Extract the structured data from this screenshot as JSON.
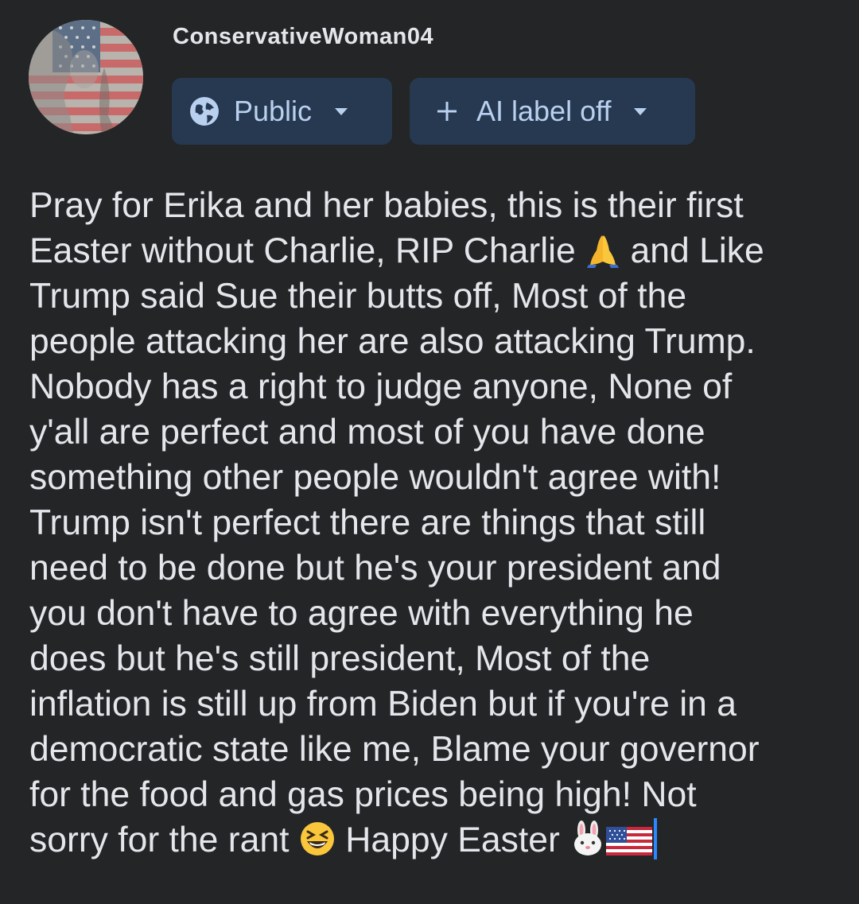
{
  "author": {
    "name": "ConservativeWoman04",
    "avatar_icon": "avatar-flag-portrait"
  },
  "privacy_chip": {
    "icon": "globe-icon",
    "label": "Public",
    "dropdown_icon": "caret-down-icon"
  },
  "ai_chip": {
    "icon": "plus-icon",
    "label": "AI label off",
    "dropdown_icon": "caret-down-icon"
  },
  "post": {
    "lines": [
      "Pray for Erika and her babies, this is their first",
      "Easter without Charlie, RIP Charlie",
      "and Like",
      "Trump said Sue their butts off, Most of the",
      "people attacking her are also attacking Trump.",
      "Nobody has a right to judge anyone, None of",
      "y'all are perfect and most of you have done",
      "something other people wouldn't agree with!",
      "Trump isn't perfect there are things that still",
      "need to be done but he's your president and",
      "you don't have to agree with everything he",
      "does but he's still president, Most of the",
      "inflation is still up from Biden but if you're in a",
      "democratic state like me, Blame your governor",
      "for the food and gas prices being high! Not",
      "sorry for the rant",
      "Happy Easter"
    ],
    "emojis": [
      "folded-hands-emoji",
      "grinning-squinting-face-emoji",
      "rabbit-face-emoji",
      "us-flag-emoji"
    ]
  },
  "colors": {
    "background": "#242526",
    "text": "#e4e6eb",
    "chip_background": "#263951",
    "chip_text": "#b9d0ef",
    "cursor": "#2d88ff"
  }
}
